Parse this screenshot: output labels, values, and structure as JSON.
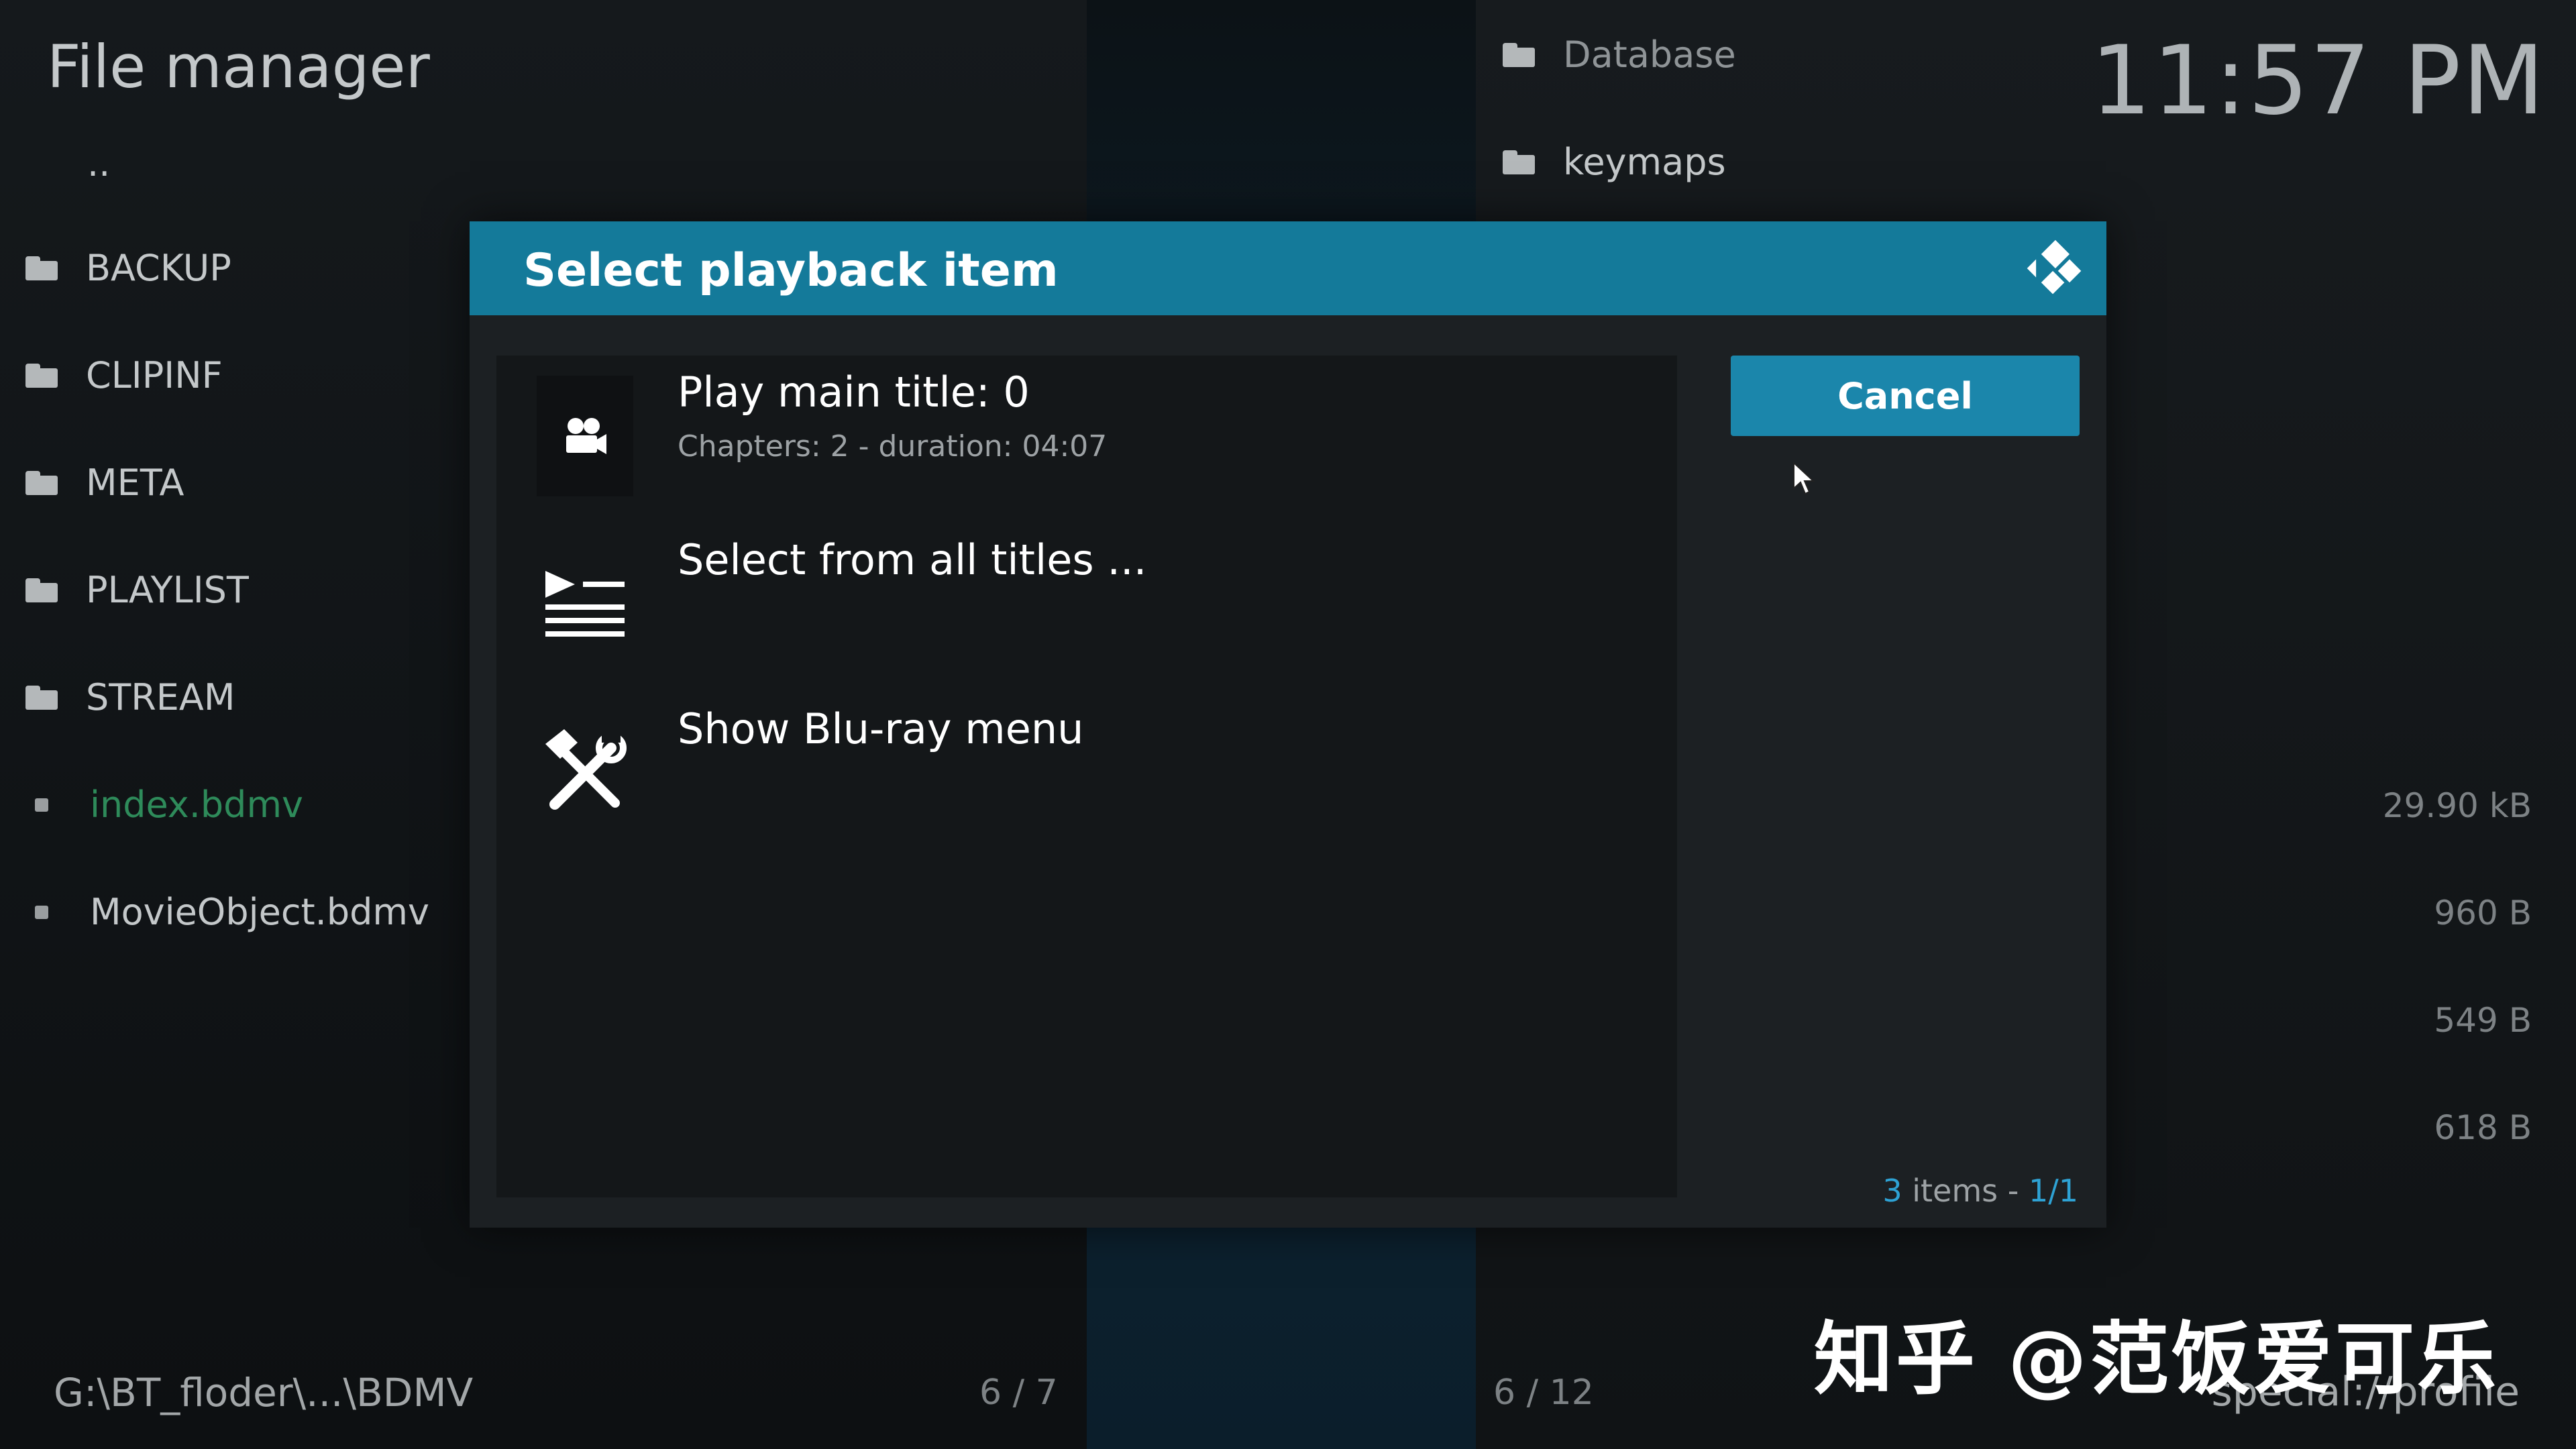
{
  "app": {
    "title": "File manager",
    "clock": "11:57 PM"
  },
  "left_pane": {
    "parent": "..",
    "items": [
      {
        "label": "BACKUP",
        "type": "folder"
      },
      {
        "label": "CLIPINF",
        "type": "folder"
      },
      {
        "label": "META",
        "type": "folder"
      },
      {
        "label": "PLAYLIST",
        "type": "folder"
      },
      {
        "label": "STREAM",
        "type": "folder"
      },
      {
        "label": "index.bdmv",
        "type": "file",
        "active": true
      },
      {
        "label": "MovieObject.bdmv",
        "type": "file"
      }
    ],
    "path": "G:\\BT_floder\\...\\BDMV",
    "count": "6 / 7"
  },
  "right_pane": {
    "items": [
      {
        "label": "Database",
        "type": "folder"
      },
      {
        "label": "keymaps",
        "type": "folder"
      }
    ],
    "sizes": [
      "29.90 kB",
      "960 B",
      "549 B",
      "618 B"
    ],
    "count": "6 / 12",
    "path": "special://profile"
  },
  "dialog": {
    "title": "Select playback item",
    "items": [
      {
        "label": "Play main title: 0",
        "sub": "Chapters: 2 - duration: 04:07",
        "icon": "video-camera-icon"
      },
      {
        "label": "Select from all titles ...",
        "icon": "playlist-icon"
      },
      {
        "label": "Show Blu-ray menu",
        "icon": "tools-icon"
      }
    ],
    "cancel_label": "Cancel",
    "count_num": "3",
    "count_word": " items - ",
    "count_page": "1/1"
  },
  "watermark": "知乎 @范饭爱可乐",
  "colors": {
    "accent": "#147a9a",
    "button": "#1b86ab",
    "active_file": "#2e8b5a",
    "count_accent": "#2ea2d4"
  }
}
